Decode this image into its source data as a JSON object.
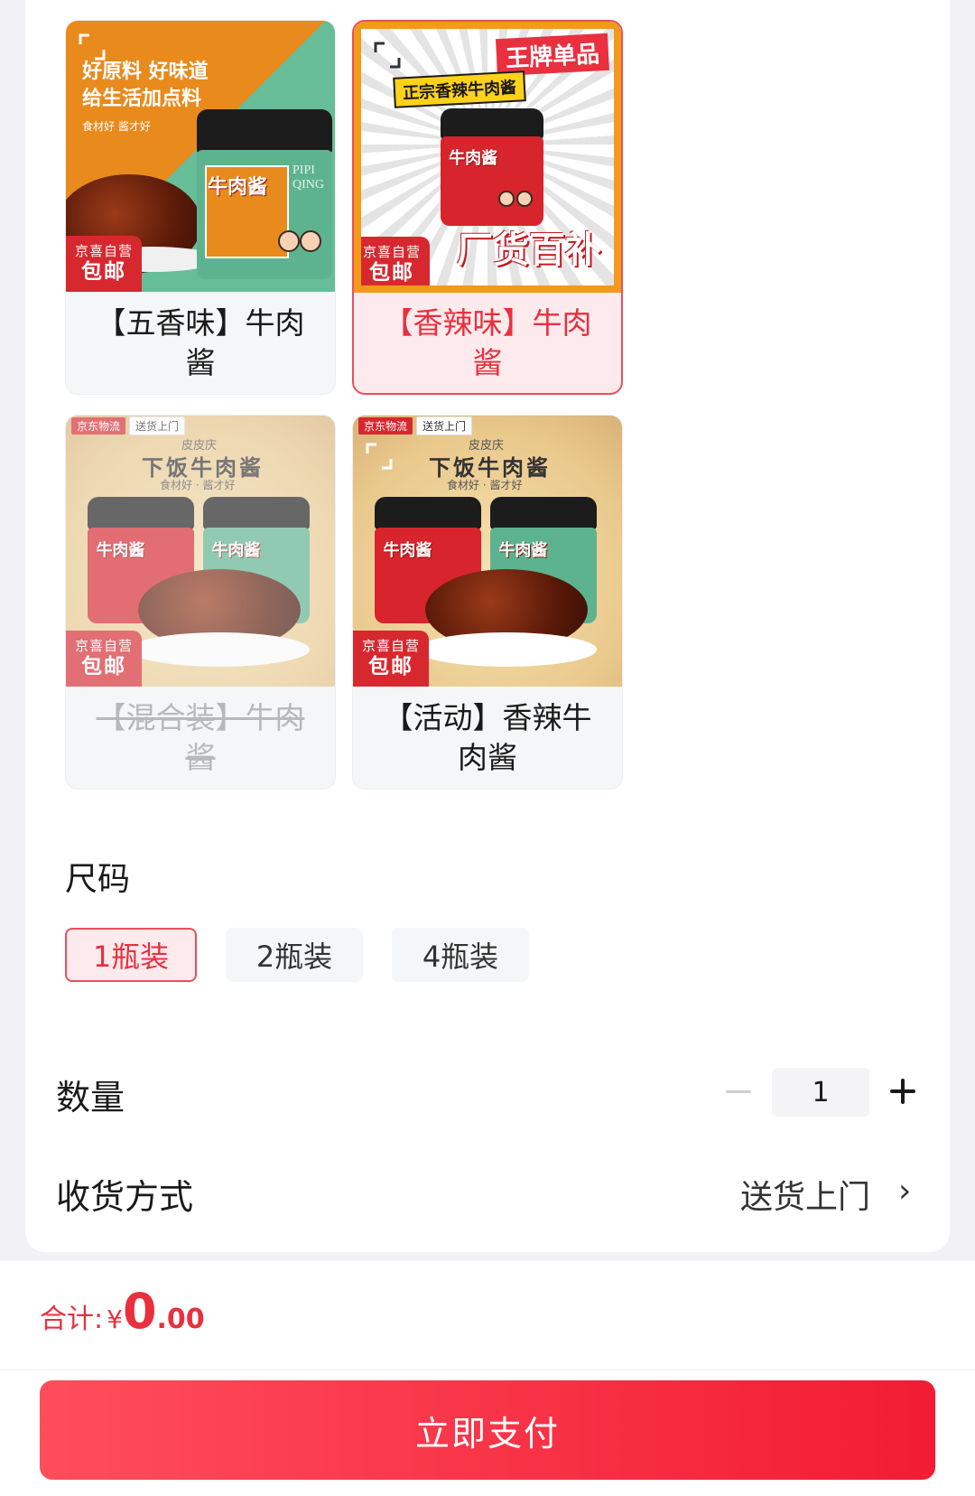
{
  "variants": [
    {
      "name": "【五香味】牛肉酱",
      "state": "normal",
      "badge_top": "京喜自营",
      "badge_bottom": "包邮",
      "banner_line1": "好原料 好味道",
      "banner_line2": "给生活加点料",
      "banner_line3": "食材好 酱才好",
      "jar_label": "牛肉酱"
    },
    {
      "name": "【香辣味】牛肉酱",
      "state": "selected",
      "badge_top": "京喜自营",
      "badge_bottom": "包邮",
      "banner_line1": "王牌单品",
      "banner_line2": "正宗香辣牛肉酱",
      "banner_line3": "厂货百补",
      "jar_label": "牛肉酱"
    },
    {
      "name": "【混合装】牛肉酱",
      "state": "disabled",
      "badge_top": "京喜自营",
      "badge_bottom": "包邮",
      "strip_1": "京东物流",
      "strip_2": "送货上门",
      "banner_line1": "下饭牛肉酱",
      "banner_line2": "食材好 · 酱才好",
      "brand": "皮皮庆",
      "jar_label": "牛肉酱"
    },
    {
      "name": "【活动】香辣牛肉酱",
      "state": "normal",
      "badge_top": "京喜自营",
      "badge_bottom": "包邮",
      "strip_1": "京东物流",
      "strip_2": "送货上门",
      "banner_line1": "下饭牛肉酱",
      "banner_line2": "食材好 · 酱才好",
      "brand": "皮皮庆",
      "jar_label": "牛肉酱"
    }
  ],
  "size_section": {
    "title": "尺码",
    "options": [
      {
        "label": "1瓶装",
        "selected": true
      },
      {
        "label": "2瓶装",
        "selected": false
      },
      {
        "label": "4瓶装",
        "selected": false
      }
    ]
  },
  "quantity": {
    "label": "数量",
    "value": "1"
  },
  "delivery": {
    "label": "收货方式",
    "value": "送货上门",
    "chevron": "›"
  },
  "total": {
    "label": "合计:",
    "currency": "¥",
    "integer": "0",
    "decimal": ".00"
  },
  "pay_button": "立即支付",
  "colors": {
    "accent": "#e8303f",
    "badge": "#d7282f",
    "selected_bg": "#fdeaec"
  }
}
